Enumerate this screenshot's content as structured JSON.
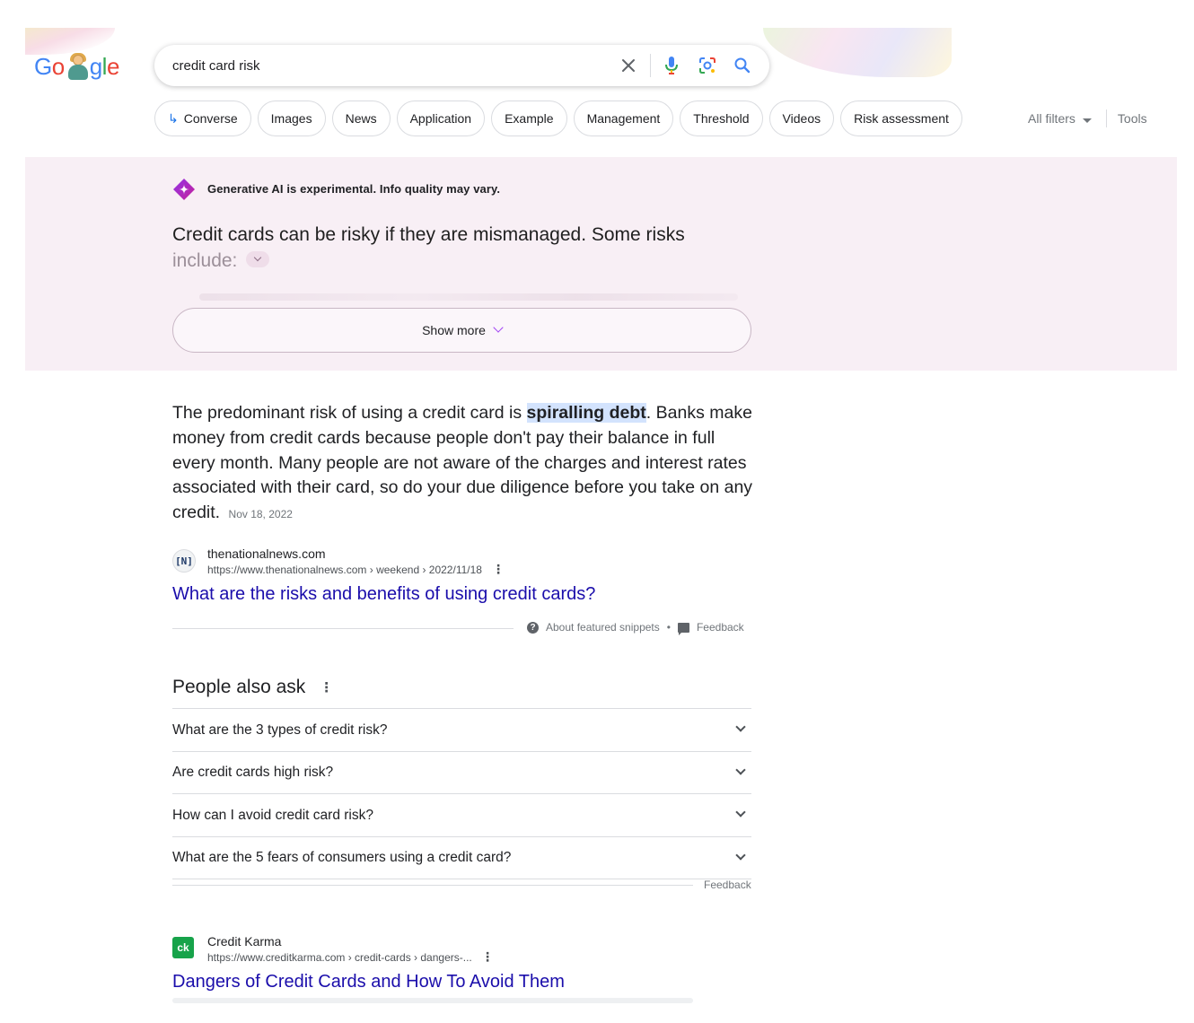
{
  "logo": {
    "text_part1": "Go",
    "text_part2": "gle"
  },
  "search": {
    "value": "credit card risk",
    "placeholder": ""
  },
  "chips": [
    {
      "label": "Converse",
      "icon": "arrow-return-icon"
    },
    {
      "label": "Images"
    },
    {
      "label": "News"
    },
    {
      "label": "Application"
    },
    {
      "label": "Example"
    },
    {
      "label": "Management"
    },
    {
      "label": "Threshold"
    },
    {
      "label": "Videos"
    },
    {
      "label": "Risk assessment"
    }
  ],
  "filters": {
    "all_filters": "All filters",
    "tools": "Tools"
  },
  "ai_overview": {
    "notice": "Generative AI is experimental. Info quality may vary.",
    "text_main": "Credit cards can be risky if they are mismanaged. Some risks",
    "text_faded": "include:",
    "show_more": "Show more"
  },
  "featured_snippet": {
    "before": "The predominant risk of using a credit card is ",
    "highlight": "spiralling debt",
    "after": ". Banks make money from credit cards because people don't pay their balance in full every month. Many people are not aware of the charges and interest rates associated with their card, so do your due diligence before you take on any credit.",
    "date": "Nov 18, 2022",
    "source_name": "thenationalnews.com",
    "source_url": "https://www.thenationalnews.com › weekend › 2022/11/18",
    "title": "What are the risks and benefits of using credit cards?",
    "about": "About featured snippets",
    "separator": "•",
    "feedback": "Feedback"
  },
  "people_also_ask": {
    "title": "People also ask",
    "questions": [
      "What are the 3 types of credit risk?",
      "Are credit cards high risk?",
      "How can I avoid credit card risk?",
      "What are the 5 fears of consumers using a credit card?"
    ],
    "feedback": "Feedback"
  },
  "result2": {
    "favicon_text": "ck",
    "source_name": "Credit Karma",
    "source_url": "https://www.creditkarma.com › credit-cards › dangers-...",
    "title": "Dangers of Credit Cards and How To Avoid Them"
  },
  "colors": {
    "link": "#1a0dab",
    "ai_panel_bg": "#f8eff5",
    "highlight_bg": "#d3e3fd",
    "accent_purple": "#a142f4"
  }
}
